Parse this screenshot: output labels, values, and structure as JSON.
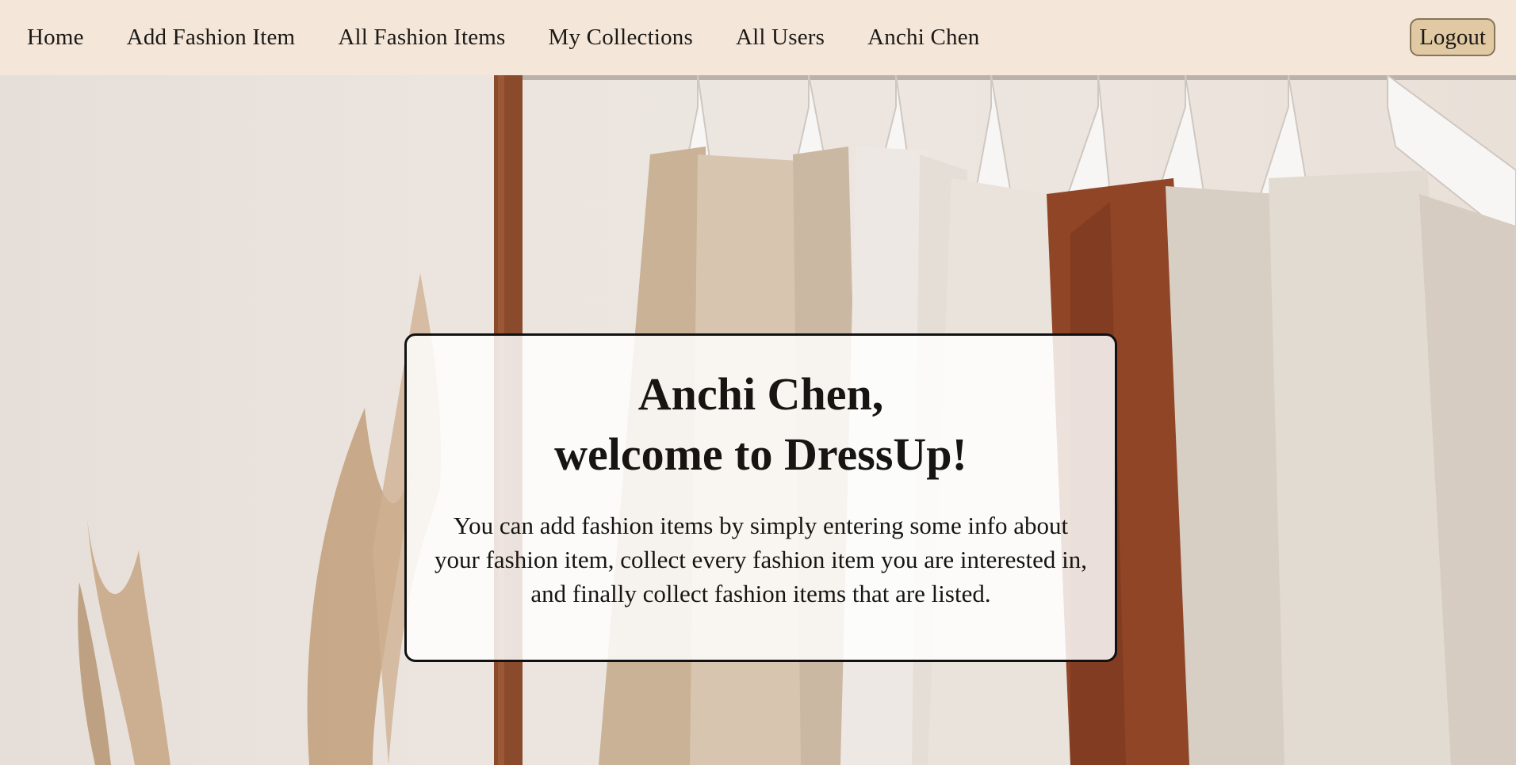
{
  "nav": {
    "links": [
      {
        "label": "Home"
      },
      {
        "label": "Add Fashion Item"
      },
      {
        "label": "All Fashion Items"
      },
      {
        "label": "My Collections"
      },
      {
        "label": "All Users"
      },
      {
        "label": "Anchi Chen"
      }
    ],
    "logout_label": "Logout"
  },
  "welcome": {
    "line1": "Anchi Chen,",
    "line2": "welcome to DressUp!",
    "description": "You can add fashion items by simply entering some info about your fashion item, collect every fashion item you are interested in, and finally collect fashion items that are listed."
  },
  "colors": {
    "navbar_bg": "#f4e6d8",
    "logout_bg": "#e1c9a3",
    "logout_border": "#857658",
    "text": "#1c1a17"
  }
}
